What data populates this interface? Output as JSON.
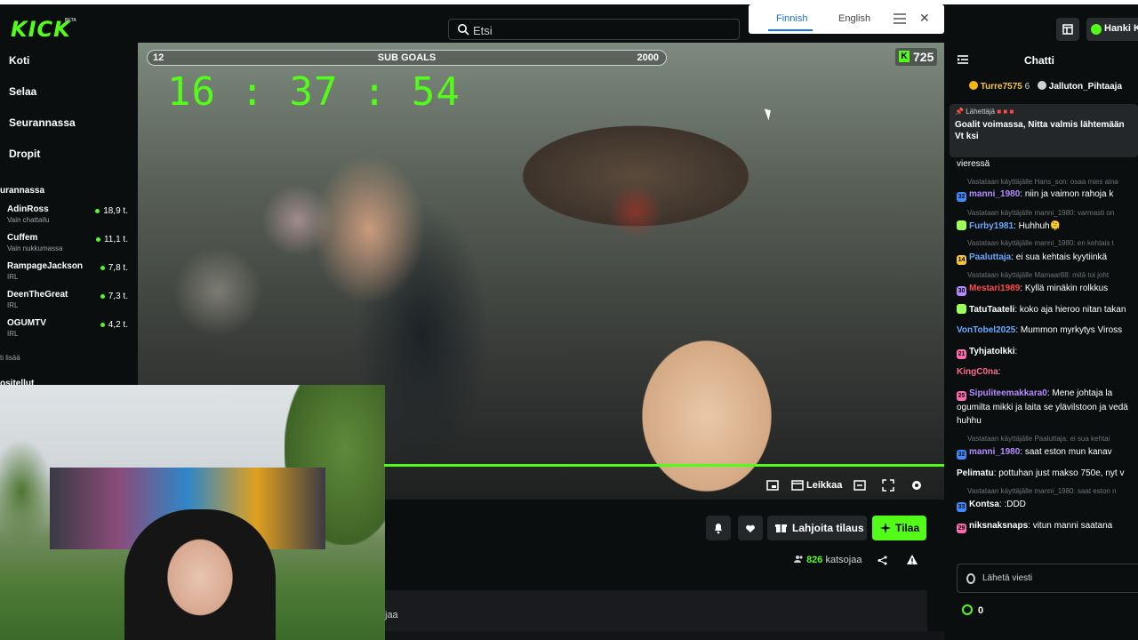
{
  "header": {
    "logo": "KICK",
    "logo_badge": "BETA",
    "search_placeholder": "Etsi",
    "user_label": "Hanki K"
  },
  "translate_bar": {
    "lang_from": "Finnish",
    "lang_to": "English",
    "close": "✕"
  },
  "sidebar": {
    "nav": [
      "Koti",
      "Selaa",
      "Seurannassa",
      "Dropit"
    ],
    "following_title": "urannassa",
    "channels": [
      {
        "name": "AdinRoss",
        "sub": "Vain chattailu",
        "viewers": "18,9 t."
      },
      {
        "name": "Cuffem",
        "sub": "Vain nukkumassa",
        "viewers": "11,1 t."
      },
      {
        "name": "RampageJackson",
        "sub": "IRL",
        "viewers": "7,8 t."
      },
      {
        "name": "DeenTheGreat",
        "sub": "IRL",
        "viewers": "7,3 t."
      },
      {
        "name": "OGUMTV",
        "sub": "IRL",
        "viewers": "4,2 t."
      }
    ],
    "show_more": "ti lisää",
    "recommended": "ositellut"
  },
  "video": {
    "goal_left": "12",
    "goal_title": "SUB GOALS",
    "goal_right": "2000",
    "countdown": "16 : 37 : 54",
    "kick_count": "725",
    "clip_label": "Leikkaa"
  },
  "info": {
    "gift_label": "Lahjoita tilaus",
    "sub_label": "Tilaa",
    "viewer_count": "826",
    "viewer_label": "katsojaa",
    "about_text": "jaa"
  },
  "chat": {
    "title": "Chatti",
    "gifters": [
      {
        "name": "Turre7575",
        "count": "6"
      },
      {
        "name": "Jalluton_Pihtaaja"
      }
    ],
    "pinned_label": "Lähettäjä",
    "pinned_text": "Goalit voimassa, Nitta valmis lähtemään Vt ksi",
    "messages": [
      {
        "type": "text",
        "text": "vieressä"
      },
      {
        "type": "reply",
        "text": "Vastataan käyttäjälle Hans_son: osaa mies aina"
      },
      {
        "type": "msg",
        "badge": "32",
        "user": "manni_1980",
        "color": "#b58cff",
        "text": ": niin ja vaimon rahoja k"
      },
      {
        "type": "reply",
        "text": "Vastataan käyttäjälle manni_1980: varmasti on"
      },
      {
        "type": "msg",
        "badge": "",
        "user": "Furby1981",
        "color": "#6aa8ff",
        "text": ": Huhhuh🫠"
      },
      {
        "type": "reply",
        "text": "Vastataan käyttäjälle manni_1980: en kehtais t"
      },
      {
        "type": "msg",
        "badge": "14",
        "user": "Paaluttaja",
        "color": "#6aa8ff",
        "text": ": ei sua kehtais kyytiinkä"
      },
      {
        "type": "reply",
        "text": "Vastataan käyttäjälle Mamaar88: mitä toi joht"
      },
      {
        "type": "msg",
        "badge": "30",
        "user": "Mestari1989",
        "color": "#ff4a4a",
        "text": ": Kyllä minäkin rolkkus"
      },
      {
        "type": "msg",
        "badge": "",
        "user": "TatuTaateli",
        "color": "#ffffff",
        "text": ": koko aja hieroo nitan takan"
      },
      {
        "type": "msg",
        "badge": "",
        "user": "VonTobel2025",
        "color": "#6aa8ff",
        "text": ": Mummon myrkytys Viross"
      },
      {
        "type": "msg",
        "badge": "21",
        "user": "Tyhjatolkki",
        "color": "#ffffff",
        "text": ":"
      },
      {
        "type": "msg",
        "badge": "",
        "user": "KingC0na",
        "color": "#ff6a8a",
        "text": ":"
      },
      {
        "type": "msg",
        "badge": "25",
        "user": "Sipuliteemakkara0",
        "color": "#b58cff",
        "text": ": Mene johtaja la"
      },
      {
        "type": "text",
        "text": "ogumilta mikki ja laita se ylävilstoon ja vedä"
      },
      {
        "type": "text",
        "text": "huhhu"
      },
      {
        "type": "reply",
        "text": "Vastataan käyttäjälle Paaluttaja: ei sua kehtai"
      },
      {
        "type": "msg",
        "badge": "32",
        "user": "manni_1980",
        "color": "#b58cff",
        "text": ": saat eston mun kanav"
      },
      {
        "type": "msg",
        "badge": "",
        "user": "Pelimatu",
        "color": "#ffffff",
        "text": ": pottuhan just makso 750e, nyt v"
      },
      {
        "type": "reply",
        "text": "Vastataan käyttäjälle manni_1980: saat eston n"
      },
      {
        "type": "msg",
        "badge": "33",
        "user": "Kontsa",
        "color": "#ffffff",
        "text": ": :DDD"
      },
      {
        "type": "msg",
        "badge": "29",
        "user": "niksnaksnaps",
        "color": "#ffffff",
        "text": ": vitun manni saatana"
      }
    ],
    "input_placeholder": "Lähetä viesti",
    "points": "0"
  }
}
